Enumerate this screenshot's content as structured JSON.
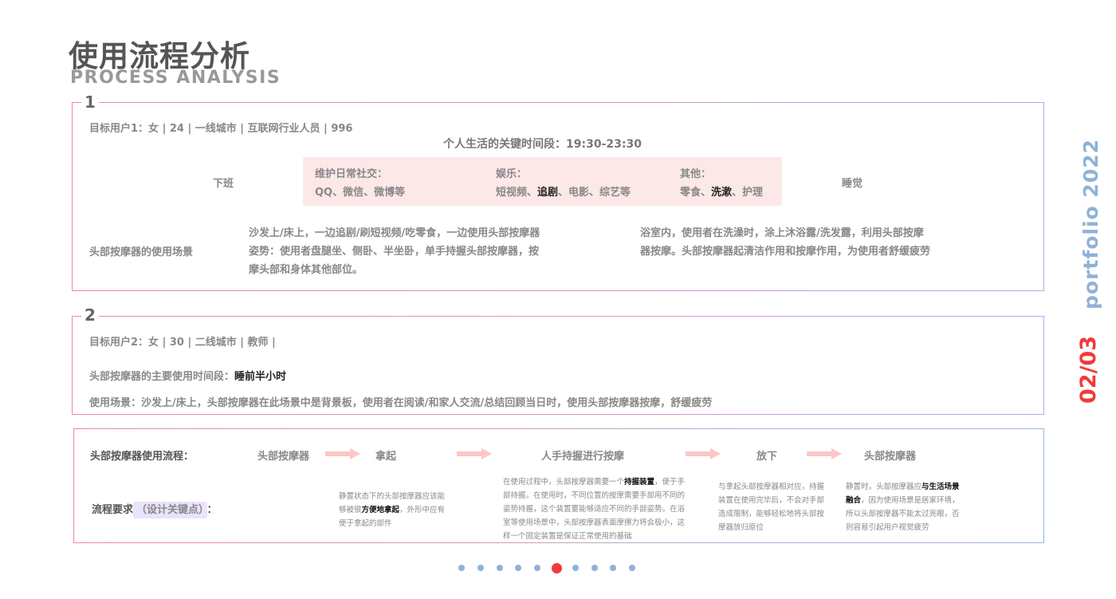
{
  "header": {
    "title": "使用流程分析",
    "subtitle": "PROCESS ANALYSIS"
  },
  "side": {
    "portfolio": "portfolio 2022",
    "page": "02/03"
  },
  "section1": {
    "number": "1",
    "user": "目标用户1：女 | 24 | 一线城市 | 互联网行业人员 | 996",
    "time_label": "个人生活的关键时间段：19:30-23:30",
    "off_work": "下班",
    "sleep": "睡觉",
    "social_title": "维护日常社交：",
    "social_items": "QQ、微信、微博等",
    "ent_title": "娱乐：",
    "ent_pre": "短视频、",
    "ent_bold": "追剧",
    "ent_post": "、电影、综艺等",
    "other_title": "其他：",
    "other_pre": "零食、",
    "other_bold": "洗漱",
    "other_post": "、护理",
    "scene_label": "头部按摩器的使用场景",
    "scene1": [
      "沙发上/床上，一边追剧/刷短视频/吃零食，一边使用头部按摩器",
      "姿势：使用者盘腿坐、侧卧、半坐卧，单手持握头部按摩器，按",
      "摩头部和身体其他部位。"
    ],
    "scene2": [
      "浴室内，使用者在洗澡时，涂上沐浴露/洗发露，利用头部按摩",
      "器按摩。头部按摩器起清洁作用和按摩作用，为使用者舒缓疲劳"
    ]
  },
  "section2": {
    "number": "2",
    "user": "目标用户2：女 | 30 | 二线城市 | 教师 |",
    "time_label": "头部按摩器的主要使用时间段：",
    "time_value": "睡前半小时",
    "scene": "使用场景：沙发上/床上，头部按摩器在此场景中是背景板，使用者在阅读/和家人交流/总结回顾当日时，使用头部按摩器按摩，舒缓疲劳"
  },
  "section3": {
    "flow_label": "头部按摩器使用流程：",
    "steps": [
      "头部按摩器",
      "拿起",
      "人手持握进行按摩",
      "放下",
      "头部按摩器"
    ],
    "req_label": "流程要求",
    "req_tag": "（设计关键点）",
    "req_colon": "：",
    "req1": {
      "a": "静置状态下的头部按摩器应该能够被很",
      "b": "方便地拿起",
      "c": "，外形中应有便于拿起的部件"
    },
    "req2": {
      "a": "在使用过程中，头部按摩器需要一个",
      "b": "持握装置",
      "c": "，便于手部持握。在使用时，不同位置的按摩需要手部用不同的姿势持握，这个装置要能够适应不同的手部姿势。在浴室等使用场景中，头部按摩器表面摩擦力将会极小，这样一个固定装置是保证正常使用的基础"
    },
    "req3": "与拿起头部按摩器相对应，持握装置在使用完毕后，不会对手部造成限制，能够轻松地将头部按摩器放归原位",
    "req4": {
      "a": "静置时，头部按摩器应",
      "b": "与生活场景融合",
      "c": "，因为使用场景是居家环境，所以头部按摩器不能太过亮眼，否则容易引起用户视觉疲劳"
    }
  },
  "pagination": {
    "total": 10,
    "active": 6
  },
  "colors": {
    "accent_red": "#f03a3a",
    "accent_blue": "#8fb2d6",
    "pink_bg": "#fde8e8"
  }
}
